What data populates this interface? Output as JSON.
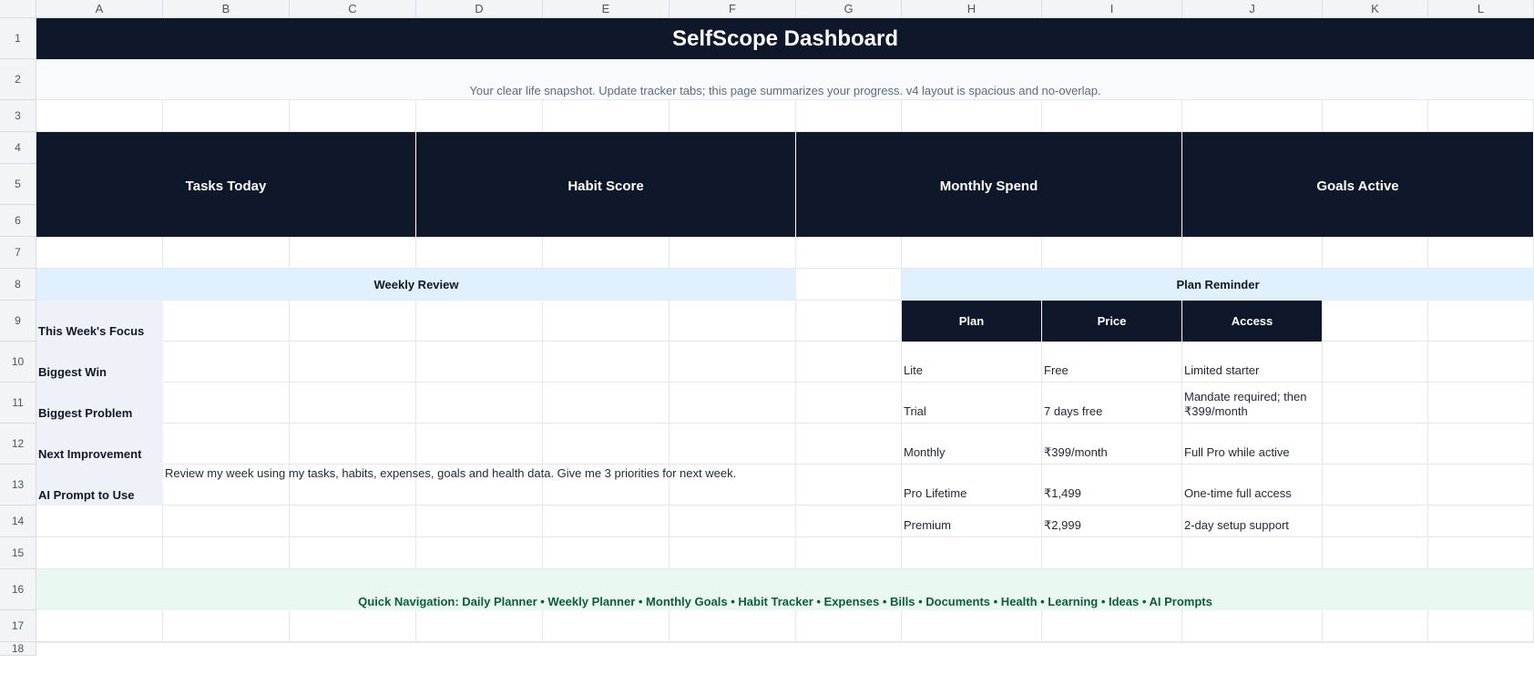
{
  "columns": [
    "A",
    "B",
    "C",
    "D",
    "E",
    "F",
    "G",
    "H",
    "I",
    "J",
    "K",
    "L"
  ],
  "rows": [
    "1",
    "2",
    "3",
    "4",
    "5",
    "6",
    "7",
    "8",
    "9",
    "10",
    "11",
    "12",
    "13",
    "14",
    "15",
    "16",
    "17",
    "18"
  ],
  "title": "SelfScope Dashboard",
  "subtitle": "Your clear life snapshot. Update tracker tabs; this page summarizes your progress. v4 layout is spacious and no-overlap.",
  "kpis": [
    "Tasks Today",
    "Habit Score",
    "Monthly Spend",
    "Goals Active"
  ],
  "weekly_review": {
    "header": "Weekly Review",
    "labels": [
      "This Week's Focus",
      "Biggest Win",
      "Biggest Problem",
      "Next Improvement",
      "AI Prompt to Use"
    ],
    "ai_prompt": "Review my week using my tasks, habits, expenses, goals and health data. Give me 3 priorities for next week."
  },
  "plan_reminder": {
    "header": "Plan Reminder",
    "columns": [
      "Plan",
      "Price",
      "Access"
    ],
    "rows": [
      [
        "Lite",
        "Free",
        "Limited starter"
      ],
      [
        "Trial",
        "7 days free",
        "Mandate required; then ₹399/month"
      ],
      [
        "Monthly",
        "₹399/month",
        "Full Pro while active"
      ],
      [
        "Pro Lifetime",
        "₹1,499",
        "One-time full access"
      ],
      [
        "Premium",
        "₹2,999",
        "2-day setup support"
      ]
    ]
  },
  "quick_nav": "Quick Navigation: Daily Planner • Weekly Planner • Monthly Goals • Habit Tracker • Expenses • Bills • Documents • Health • Learning • Ideas • AI Prompts",
  "colors": {
    "dark_header": "#0f172a",
    "weekly_band": "#e0f0fc",
    "nav_band": "#e9f9f2",
    "nav_text": "#0b5e3c",
    "subtitle_text": "#5b6b80",
    "label_bg": "#eef2f8"
  }
}
